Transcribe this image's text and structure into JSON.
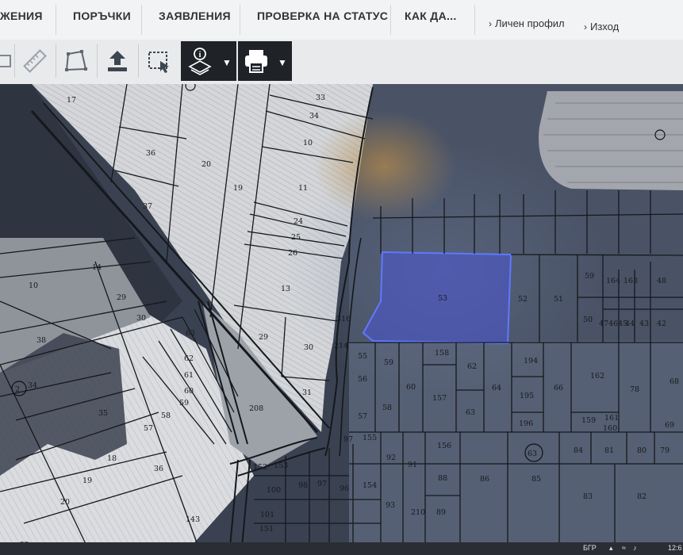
{
  "nav": {
    "items": [
      "ЖЕНИЯ",
      "ПОРЪЧКИ",
      "ЗАЯВЛЕНИЯ",
      "ПРОВЕРКА НА СТАТУС",
      "КАК ДА..."
    ],
    "profile": "Личен профил",
    "logout": "Изход"
  },
  "toolbar": {
    "icons": [
      "pan-icon",
      "measure-ruler-icon",
      "draw-polygon-icon",
      "upload-icon",
      "select-area-icon",
      "layers-info-icon",
      "print-icon"
    ]
  },
  "map": {
    "selected_parcel": "53",
    "selected_color": "#4b55d6",
    "circled_numbers": [
      "2",
      "63"
    ],
    "parcel_numbers": [
      "17",
      "33",
      "34",
      "10",
      "36",
      "20",
      "19",
      "11",
      "37",
      "24",
      "25",
      "26",
      "14",
      "13",
      "10",
      "29",
      "30",
      "316",
      "38",
      "63",
      "62",
      "61",
      "60",
      "59",
      "2",
      "34",
      "35",
      "58",
      "57",
      "18",
      "36",
      "29",
      "30",
      "31",
      "208",
      "19",
      "20",
      "143",
      "152",
      "153",
      "100",
      "98",
      "97",
      "96",
      "154",
      "93",
      "101",
      "151",
      "22",
      "214",
      "55",
      "56",
      "57",
      "97",
      "155",
      "92",
      "91",
      "210",
      "89",
      "59",
      "60",
      "58",
      "158",
      "62",
      "157",
      "63",
      "156",
      "88",
      "86",
      "85",
      "52",
      "51",
      "50",
      "59",
      "164",
      "163",
      "48",
      "474645",
      "44",
      "43",
      "42",
      "194",
      "162",
      "195",
      "196",
      "159",
      "161",
      "160",
      "66",
      "64",
      "78",
      "68",
      "69",
      "84",
      "81",
      "80",
      "79",
      "83",
      "82",
      "63",
      "53"
    ]
  },
  "taskbar": {
    "language": "БГР",
    "clock": "12:6"
  }
}
